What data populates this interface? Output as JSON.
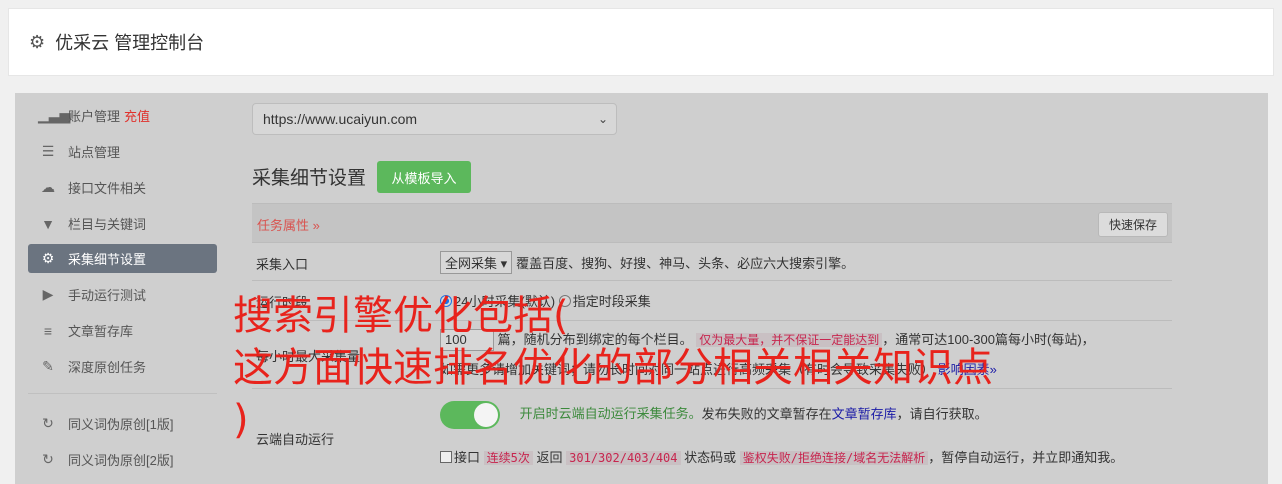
{
  "header": {
    "gear_icon": "gear-icon",
    "title": "优采云 管理控制台"
  },
  "sidebar": {
    "items": [
      {
        "label": "账户管理",
        "extra": "充值",
        "icon": "bar-chart-icon",
        "glyph": "▁▃▅"
      },
      {
        "label": "站点管理",
        "icon": "server-icon",
        "glyph": "☰"
      },
      {
        "label": "接口文件相关",
        "icon": "cloud-upload-icon",
        "glyph": "☁"
      },
      {
        "label": "栏目与关键词",
        "icon": "filter-icon",
        "glyph": "▼"
      },
      {
        "label": "采集细节设置",
        "icon": "gears-icon",
        "glyph": "⚙"
      },
      {
        "label": "手动运行测试",
        "icon": "play-circle-icon",
        "glyph": "▶"
      },
      {
        "label": "文章暂存库",
        "icon": "database-icon",
        "glyph": "≡"
      },
      {
        "label": "深度原创任务",
        "icon": "edit-icon",
        "glyph": "✎"
      },
      {
        "label": "同义词伪原创[1版]",
        "icon": "refresh-icon",
        "glyph": "↻"
      },
      {
        "label": "同义词伪原创[2版]",
        "icon": "refresh-icon",
        "glyph": "↻"
      }
    ],
    "active_index": 4
  },
  "main": {
    "site_select": {
      "value": "https://www.ucaiyun.com"
    },
    "section_title": "采集细节设置",
    "import_button": "从模板导入",
    "table": {
      "head_label": "任务属性 »",
      "quick_save": "快速保存",
      "rows": {
        "entry": {
          "label": "采集入口",
          "select": "全网采集 ▾",
          "text": "覆盖百度、搜狗、好搜、神马、头条、必应六大搜索引擎。"
        },
        "time": {
          "label": "运行时段",
          "opt1": "24小时采集(默认)",
          "opt2": "指定时段采集"
        },
        "max": {
          "label": "每小时最大采集量",
          "input": "100",
          "text1": "篇，随机分布到绑定的每个栏目。",
          "badge": "仅为最大量，并不保证一定能达到",
          "text2": "，通常可达100-300篇每小时(每站)，",
          "line2": "如需更多请增加关键词；请勿长时间对同一站点进行高频采集（有时会导致采集失败）",
          "link": "影响因素»"
        },
        "cloud": {
          "label": "云端自动运行",
          "toggle_on": true,
          "text_green": "开启时云端自动运行采集任务。",
          "text_mid": "发布失败的文章暂存在",
          "link": "文章暂存库",
          "text_end": "，请自行获取。",
          "line2_a": "接口",
          "code1": "连续5次",
          "line2_b": "返回",
          "code2": "301/302/403/404",
          "line2_c": "状态码或",
          "code3": "鉴权失败/拒绝连接/域名无法解析",
          "line2_d": "，暂停自动运行，并立即通知我。"
        }
      }
    }
  },
  "overlay": {
    "line1": "搜索引擎优化包括(",
    "line2": "这方面快速排名优化的部分相关相关知识点",
    "line3": ")",
    "color": "#e8231c"
  },
  "colors": {
    "active_sidebar": "#6b7480",
    "import_button": "#5cb85c",
    "danger": "#d9534f"
  }
}
